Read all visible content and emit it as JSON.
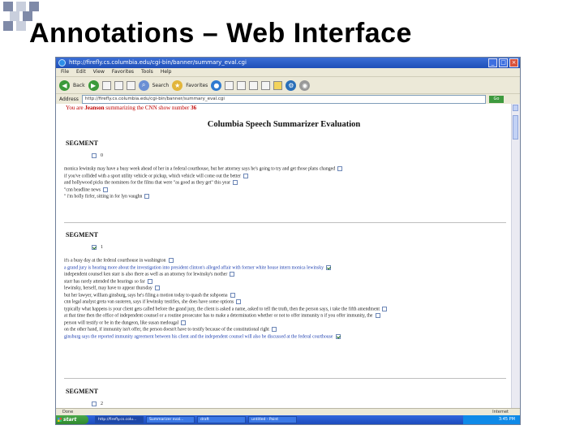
{
  "slide": {
    "title": "Annotations – Web Interface",
    "colors": {
      "square_dark": "#7f8aa8",
      "square_light": "#c9cfdd"
    }
  },
  "browser": {
    "title": "http://firefly.cs.columbia.edu/cgi-bin/banner/summary_eval.cgi",
    "menu": [
      "File",
      "Edit",
      "View",
      "Favorites",
      "Tools",
      "Help"
    ],
    "toolbar": {
      "back_label": "Back",
      "search_label": "Search",
      "favorites_label": "Favorites"
    },
    "address": "http://firefly.cs.columbia.edu/cgi-bin/banner/summary_eval.cgi",
    "go_label": "Go",
    "status_done": "Done",
    "status_zone": "Internet"
  },
  "page": {
    "status_prefix": "You are ",
    "user": "Jeanson",
    "status_mid": " summarizing the CNN show number ",
    "show_number": "36",
    "heading": "Columbia Speech Summarizer Evaluation",
    "segments": [
      {
        "title": "SEGMENT",
        "number": "0",
        "checked": false,
        "lines": [
          {
            "text": "monica lewinsky may have a busy week ahead of her in a federal courthouse, but her attorney says he's going to try and get those plans changed",
            "checked": false,
            "blue": false
          },
          {
            "text": "if you've collided with a sport utility vehicle or pickup, which vehicle will come out the better",
            "checked": false,
            "blue": false
          },
          {
            "text": "and hollywood picks the nominees for the films that were \"as good as they get\" this year",
            "checked": false,
            "blue": false
          },
          {
            "text": "\"cnn headline news",
            "checked": false,
            "blue": false
          },
          {
            "text": "\" i'm holly firfer, sitting in for lyn vaughn",
            "checked": false,
            "blue": false
          }
        ]
      },
      {
        "title": "SEGMENT",
        "number": "1",
        "checked": true,
        "lines": [
          {
            "text": "it's a busy day at the federal courthouse in washington",
            "checked": false,
            "blue": false
          },
          {
            "text": "a grand jury is hearing more about the investigation into president clinton's alleged affair with former white house intern monica lewinsky",
            "checked": true,
            "blue": true
          },
          {
            "text": "independent counsel ken starr is also there as well as an attorney for lewinsky's mother",
            "checked": false,
            "blue": false
          },
          {
            "text": "starr has rarely attended the hearings so far",
            "checked": false,
            "blue": false
          },
          {
            "text": "lewinsky, herself, may have to appear thursday",
            "checked": false,
            "blue": false
          },
          {
            "text": "but her lawyer, william ginsburg, says he's filing a motion today to quash the subpoena",
            "checked": false,
            "blue": false
          },
          {
            "text": "cnn legal analyst greta van susteren, says if lewinsky testifies, she does have some options",
            "checked": false,
            "blue": false
          },
          {
            "text": "typically what happens is your client gets called before the grand jury, the client is asked a name, asked to tell the truth, then the person says, i take the fifth amendment",
            "checked": false,
            "blue": false
          },
          {
            "text": "at that time then the office of independent counsel or a routine prosecutor has to make a determination whether or not to offer immunity n if you offer immunity, the",
            "checked": false,
            "blue": false
          },
          {
            "text": "person will testify or be in the dungeon, like susan medougal",
            "checked": false,
            "blue": false
          },
          {
            "text": "on the other hand, if immunity isn't offer, the person doesn't have to testify because of the constitutional right",
            "checked": false,
            "blue": false
          },
          {
            "text": "ginsburg says the reported immunity agreement between his client and the independent counsel will also be discussed at the federal courthouse",
            "checked": true,
            "blue": true
          }
        ]
      },
      {
        "title": "SEGMENT",
        "number": "2",
        "checked": false,
        "lines": []
      }
    ]
  },
  "taskbar": {
    "start_label": "start",
    "tasks": [
      "http://firefly.cs.colu...",
      "Summarizer eval...",
      "draft",
      "untitled - Paint"
    ],
    "tray_time": "3:45 PM"
  }
}
